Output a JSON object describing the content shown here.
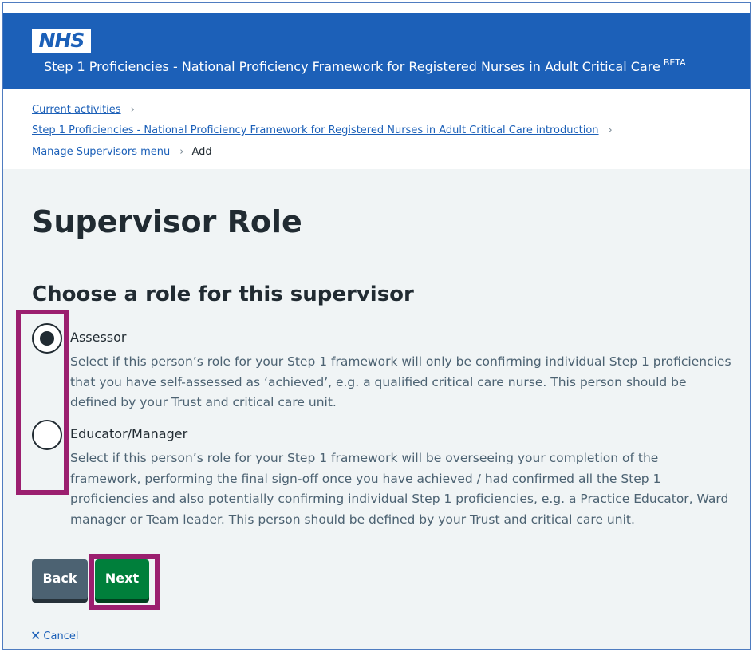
{
  "header": {
    "logo": "NHS",
    "service_name": "Step 1 Proficiencies - National Proficiency Framework for Registered Nurses in Adult Critical Care",
    "beta_tag": "BETA",
    "color": "#1c60b8"
  },
  "breadcrumbs": {
    "items": [
      "Current activities",
      "Step 1 Proficiencies - National Proficiency Framework for Registered Nurses in Adult Critical Care introduction",
      "Manage Supervisors menu"
    ],
    "current": "Add"
  },
  "page_title": "Supervisor Role",
  "form": {
    "legend": "Choose a role for this supervisor",
    "options": [
      {
        "label": "Assessor",
        "hint": "Select if this person’s role for your Step 1 framework will only be confirming individual Step 1 proficiencies that you have self-assessed as ‘achieved’, e.g. a qualified critical care nurse. This person should be defined by your Trust and critical care unit.",
        "selected": true
      },
      {
        "label": "Educator/Manager",
        "hint": "Select if this person’s role for your Step 1 framework will be overseeing your completion of the framework, performing the final sign-off once you have achieved / had confirmed all the Step 1 proficiencies and also potentially confirming individual Step 1 proficiencies, e.g. a Practice Educator, Ward manager or Team leader. This person should be defined by your Trust and critical care unit.",
        "selected": false
      }
    ]
  },
  "actions": {
    "back_label": "Back",
    "next_label": "Next",
    "cancel_label": "Cancel",
    "next_color": "#007f3b",
    "back_color": "#4c6272"
  },
  "highlight_color": "#9b1f6f"
}
